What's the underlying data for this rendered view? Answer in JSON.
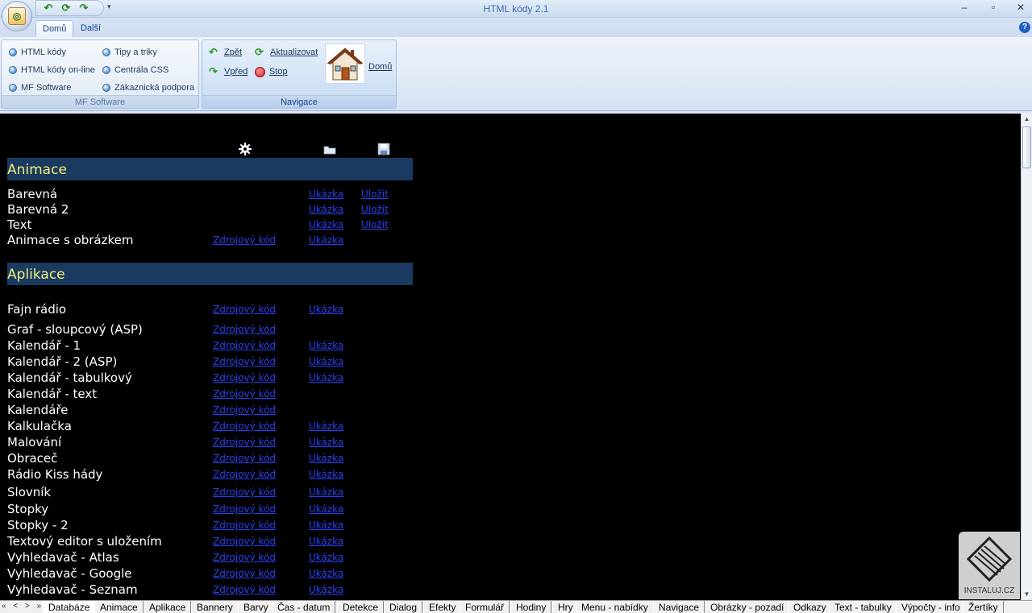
{
  "window": {
    "title": "HTML kódy 2.1"
  },
  "quick_access": {
    "more": "▾"
  },
  "tabs": [
    {
      "label": "Domů",
      "active": true
    },
    {
      "label": "Další",
      "active": false
    }
  ],
  "help": "?",
  "ribbon": {
    "mf_group": {
      "label": "MF Software",
      "items": [
        "HTML kódy",
        "Tipy a triky",
        "HTML kódy on-line",
        "Centrála CSS",
        "MF Software",
        "Zákaznická podpora"
      ]
    },
    "nav_group": {
      "label": "Navigace",
      "back": "Zpět",
      "forward": "Vpřed",
      "refresh": "Aktualizovat",
      "stop": "Stop",
      "home": "Domů"
    }
  },
  "content": {
    "sections": [
      {
        "title": "Animace",
        "rows": [
          {
            "name": "Barevná",
            "source": "",
            "demo": "Ukázka",
            "save": "Uložit"
          },
          {
            "name": "Barevná 2",
            "source": "",
            "demo": "Ukázka",
            "save": "Uložit"
          },
          {
            "name": "Text",
            "source": "",
            "demo": "Ukázka",
            "save": "Uložit"
          },
          {
            "name": "Animace s obrázkem",
            "source": "Zdrojový kód",
            "demo": "Ukázka",
            "save": ""
          }
        ]
      },
      {
        "title": "Aplikace",
        "rows": [
          {
            "name": "Fajn rádio",
            "source": "Zdrojový kód",
            "demo": "Ukázka"
          },
          {
            "name": "Graf - sloupcový (ASP)",
            "source": "Zdrojový kód",
            "demo": ""
          },
          {
            "name": "Kalendář - 1",
            "source": "Zdrojový kód",
            "demo": "Ukázka"
          },
          {
            "name": "Kalendář - 2 (ASP)",
            "source": "Zdrojový kód",
            "demo": "Ukázka"
          },
          {
            "name": "Kalendář - tabulkový",
            "source": "Zdrojový kód",
            "demo": "Ukázka"
          },
          {
            "name": "Kalendář - text",
            "source": "Zdrojový kód",
            "demo": ""
          },
          {
            "name": "Kalendáře",
            "source": "Zdrojový kód",
            "demo": ""
          },
          {
            "name": "Kalkulačka",
            "source": "Zdrojový kód",
            "demo": "Ukázka"
          },
          {
            "name": "Malování",
            "source": "Zdrojový kód",
            "demo": "Ukázka"
          },
          {
            "name": "Obraceč",
            "source": "Zdrojový kód",
            "demo": "Ukázka"
          },
          {
            "name": "Rádio Kiss hády",
            "source": "Zdrojový kód",
            "demo": "Ukázka"
          },
          {
            "name": "Slovník",
            "source": "Zdrojový kód",
            "demo": "Ukázka"
          },
          {
            "name": "Stopky",
            "source": "Zdrojový kód",
            "demo": "Ukázka"
          },
          {
            "name": "Stopky - 2",
            "source": "Zdrojový kód",
            "demo": "Ukázka"
          },
          {
            "name": "Textový editor s uložením",
            "source": "Zdrojový kód",
            "demo": "Ukázka"
          },
          {
            "name": "Vyhledavač - Atlas",
            "source": "Zdrojový kód",
            "demo": "Ukázka"
          },
          {
            "name": "Vyhledavač - Google",
            "source": "Zdrojový kód",
            "demo": "Ukázka"
          },
          {
            "name": "Vyhledavač - Seznam",
            "source": "Zdrojový kód",
            "demo": "Ukázka"
          }
        ]
      }
    ]
  },
  "bottom_nav": "« < > »",
  "bottom_tabs": [
    "Databáze",
    "Animace",
    "Aplikace",
    "Bannery",
    "Barvy",
    "Čas - datum",
    "Detekce",
    "Dialog",
    "Efekty",
    "Formulář",
    "Hodiny",
    "Hry",
    "Menu - nabídky",
    "Navigace",
    "Obrázky - pozadí",
    "Odkazy",
    "Text - tabulky",
    "Výpočty - info",
    "Žertíky"
  ],
  "watermark": {
    "text": "INSTALUJ.CZ"
  },
  "colors": {
    "section_bg": "#1a3a60",
    "section_title": "#f3f07a",
    "link": "#2b3ff0",
    "content_bg": "#000000"
  }
}
